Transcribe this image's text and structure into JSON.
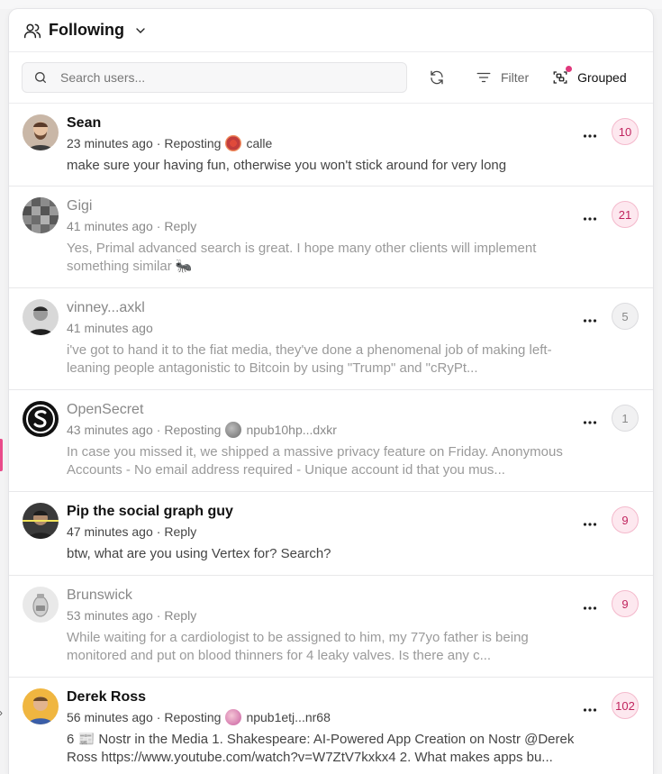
{
  "header": {
    "title": "Following"
  },
  "toolbar": {
    "search_placeholder": "Search users...",
    "filter_label": "Filter",
    "grouped_label": "Grouped"
  },
  "colors": {
    "accent": "#e0387c",
    "badge_bg": "#fde8ef",
    "badge_text": "#c0245e"
  },
  "items": [
    {
      "name": "Sean",
      "time": "23 minutes ago",
      "action": "Reposting",
      "repost_user": "calle",
      "body": "make sure your having fun, otherwise you won't stick around for very long",
      "count": "10"
    },
    {
      "name": "Gigi",
      "time": "41 minutes ago",
      "action": "Reply",
      "body": "Yes, Primal advanced search is great. I hope many other clients will implement something similar 🐜",
      "count": "21"
    },
    {
      "name": "vinney...axkl",
      "time": "41 minutes ago",
      "body": "i've got to hand it to the fiat media, they've done a phenomenal job of making left-leaning people antagonistic to Bitcoin by using \"Trump\" and \"cRyPt...",
      "count": "5"
    },
    {
      "name": "OpenSecret",
      "time": "43 minutes ago",
      "action": "Reposting",
      "repost_user": "npub10hp...dxkr",
      "body": "In case you missed it, we shipped a massive privacy feature on Friday. Anonymous Accounts - No email address required - Unique account id that you mus...",
      "count": "1"
    },
    {
      "name": "Pip the social graph guy",
      "time": "47 minutes ago",
      "action": "Reply",
      "body": "btw, what are you using Vertex for? Search?",
      "count": "9"
    },
    {
      "name": "Brunswick",
      "time": "53 minutes ago",
      "action": "Reply",
      "body": "While waiting for a cardiologist to be assigned to him, my 77yo father is being monitored and put on blood thinners for 4 leaky valves. Is there any c...",
      "count": "9"
    },
    {
      "name": "Derek Ross",
      "time": "56 minutes ago",
      "action": "Reposting",
      "repost_user": "npub1etj...nr68",
      "body": "6 📰 Nostr in the Media 1. Shakespeare: AI-Powered App Creation on Nostr @Derek Ross https://www.youtube.com/watch?v=W7ZtV7kxkx4 2. What makes apps bu...",
      "count": "102"
    }
  ]
}
